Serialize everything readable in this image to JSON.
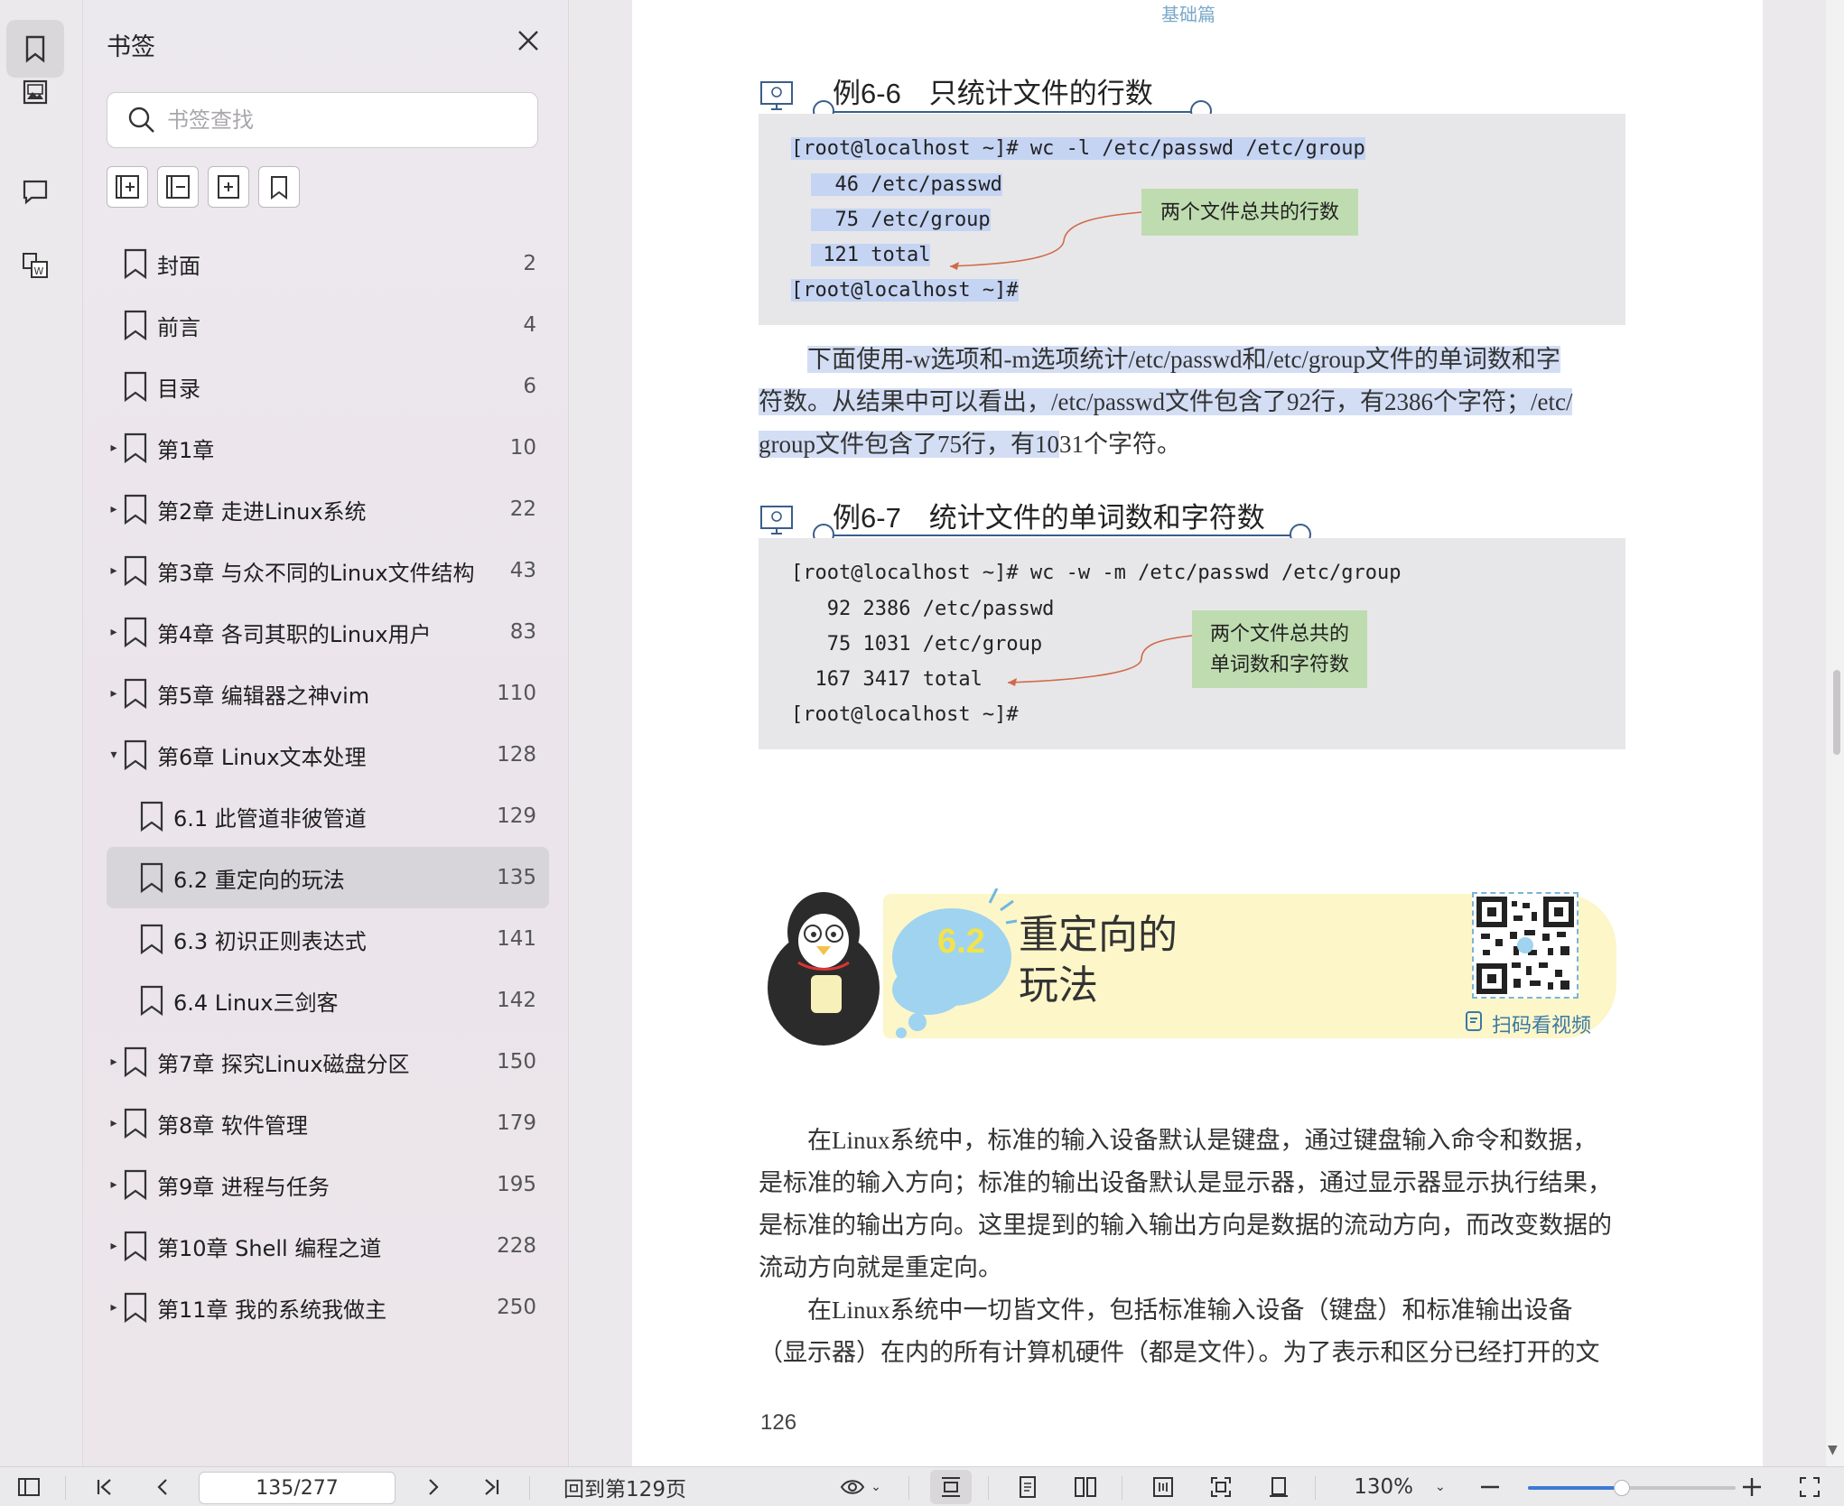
{
  "sidebar": {
    "title": "书签",
    "search_placeholder": "书签查找",
    "bookmarks": [
      {
        "label": "封面",
        "page": "2",
        "level": 0,
        "arrow": ""
      },
      {
        "label": "前言",
        "page": "4",
        "level": 0,
        "arrow": ""
      },
      {
        "label": "目录",
        "page": "6",
        "level": 0,
        "arrow": ""
      },
      {
        "label": "第1章",
        "page": "10",
        "level": 0,
        "arrow": "▸"
      },
      {
        "label": "第2章 走进Linux系统",
        "page": "22",
        "level": 0,
        "arrow": "▸"
      },
      {
        "label": "第3章 与众不同的Linux文件结构",
        "page": "43",
        "level": 0,
        "arrow": "▸"
      },
      {
        "label": "第4章 各司其职的Linux用户",
        "page": "83",
        "level": 0,
        "arrow": "▸"
      },
      {
        "label": "第5章 编辑器之神vim",
        "page": "110",
        "level": 0,
        "arrow": "▸"
      },
      {
        "label": "第6章 Linux文本处理",
        "page": "128",
        "level": 0,
        "arrow": "▾"
      },
      {
        "label": "6.1 此管道非彼管道",
        "page": "129",
        "level": 1,
        "arrow": ""
      },
      {
        "label": "6.2 重定向的玩法",
        "page": "135",
        "level": 1,
        "arrow": "",
        "selected": true
      },
      {
        "label": "6.3 初识正则表达式",
        "page": "141",
        "level": 1,
        "arrow": ""
      },
      {
        "label": "6.4 Linux三剑客",
        "page": "142",
        "level": 1,
        "arrow": ""
      },
      {
        "label": "第7章 探究Linux磁盘分区",
        "page": "150",
        "level": 0,
        "arrow": "▸"
      },
      {
        "label": "第8章 软件管理",
        "page": "179",
        "level": 0,
        "arrow": "▸"
      },
      {
        "label": "第9章 进程与任务",
        "page": "195",
        "level": 0,
        "arrow": "▸"
      },
      {
        "label": "第10章 Shell 编程之道",
        "page": "228",
        "level": 0,
        "arrow": "▸"
      },
      {
        "label": "第11章 我的系统我做主",
        "page": "250",
        "level": 0,
        "arrow": "▸"
      }
    ]
  },
  "document": {
    "running_head": "基础篇",
    "example1": {
      "title": "例6-6　只统计文件的行数",
      "lines": [
        "[root@localhost ~]# wc -l /etc/passwd /etc/group",
        "  46 /etc/passwd",
        "  75 /etc/group",
        " 121 total",
        "[root@localhost ~]#"
      ],
      "callout": "两个文件总共的行数"
    },
    "para1": {
      "line1": "下面使用-w选项和-m选项统计/etc/passwd和/etc/group文件的单词数和字",
      "line2": "符数。从结果中可以看出，/etc/passwd文件包含了92行，有2386个字符；/etc/",
      "line3a": "group文件包含了75行，有10",
      "line3b": "31个字符。"
    },
    "example2": {
      "title": "例6-7　统计文件的单词数和字符数",
      "lines": [
        "[root@localhost ~]# wc -w -m /etc/passwd /etc/group",
        "   92 2386 /etc/passwd",
        "   75 1031 /etc/group",
        "  167 3417 total",
        "[root@localhost ~]#"
      ],
      "callout_line1": "两个文件总共的",
      "callout_line2": "单词数和字符数"
    },
    "section": {
      "number": "6.2",
      "title_line1": "重定向的",
      "title_line2": "玩法",
      "scan_text": "扫码看视频"
    },
    "para2": [
      "在Linux系统中，标准的输入设备默认是键盘，通过键盘输入命令和数据，",
      "是标准的输入方向；标准的输出设备默认是显示器，通过显示器显示执行结果，",
      "是标准的输出方向。这里提到的输入输出方向是数据的流动方向，而改变数据的",
      "流动方向就是重定向。"
    ],
    "para3": [
      "在Linux系统中一切皆文件，包括标准输入设备（键盘）和标准输出设备",
      "（显示器）在内的所有计算机硬件（都是文件）。为了表示和区分已经打开的文"
    ],
    "page_number": "126"
  },
  "toolbar": {
    "page_indicator": "135/277",
    "back_to": "回到第129页",
    "zoom": "130%",
    "zoom_fraction": 0.45
  },
  "colors": {
    "accent": "#3a7bd5",
    "highlight": "#c5d4f3",
    "callout": "#bfdcb0",
    "code_bg": "#e7e7e9"
  }
}
